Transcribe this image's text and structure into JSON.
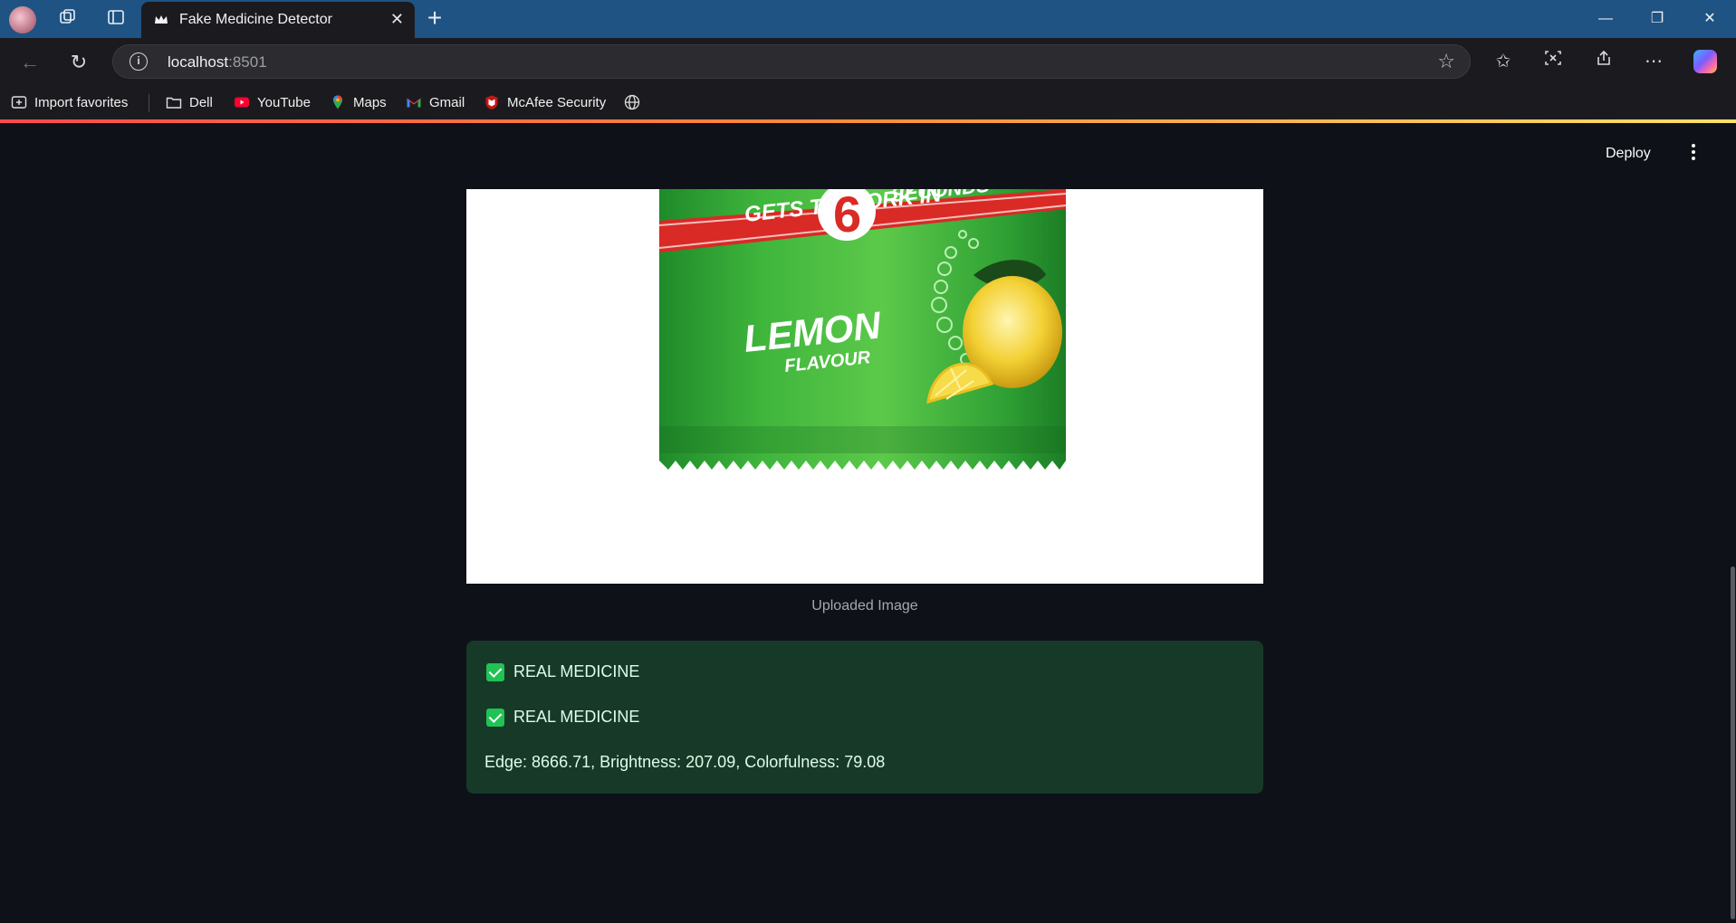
{
  "browser": {
    "tab_title": "Fake Medicine Detector",
    "url_host": "localhost",
    "url_port": ":8501",
    "favorites": [
      {
        "label": "Import favorites",
        "icon": "import-favorites-icon"
      },
      {
        "label": "Dell",
        "icon": "folder-icon"
      },
      {
        "label": "YouTube",
        "icon": "youtube-icon"
      },
      {
        "label": "Maps",
        "icon": "maps-pin-icon"
      },
      {
        "label": "Gmail",
        "icon": "gmail-icon"
      },
      {
        "label": "McAfee Security",
        "icon": "mcafee-icon"
      }
    ]
  },
  "app": {
    "deploy_label": "Deploy",
    "image_caption": "Uploaded Image",
    "product_text": {
      "banner": "GETS TO WORK IN",
      "banner_number": "6",
      "banner_tail": "SECONDS",
      "flavor": "LEMON",
      "flavor_sub": "FLAVOUR"
    },
    "result": {
      "line1": "REAL MEDICINE",
      "line2": "REAL MEDICINE",
      "metrics": "Edge: 8666.71, Brightness: 207.09, Colorfulness: 79.08"
    }
  },
  "colors": {
    "titlebar": "#1e5384",
    "app_bg": "#0e1117",
    "success_bg": "#173928",
    "success_text": "#dffde9",
    "check_green": "#21c354"
  }
}
